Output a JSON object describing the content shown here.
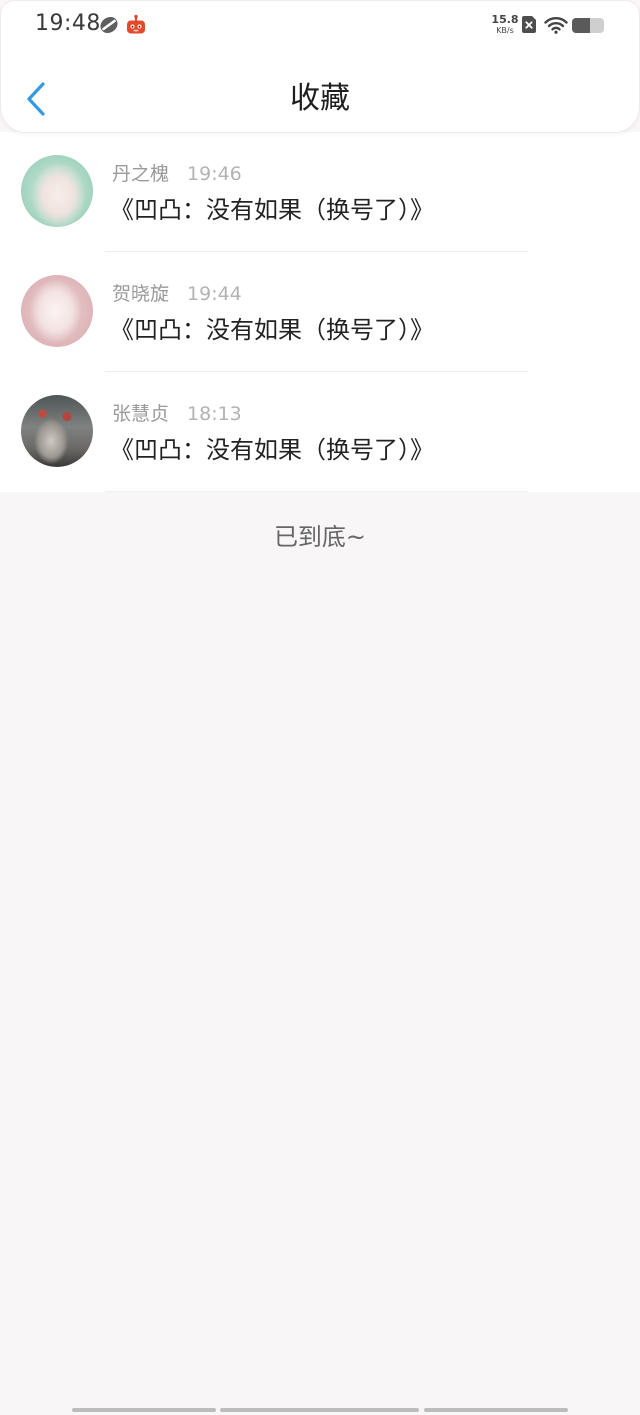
{
  "status_bar": {
    "time": "19:48",
    "notification_icons": [
      "swirl-app-icon",
      "robot-app-icon"
    ],
    "network_speed": "15.8",
    "network_speed_unit": "KB/s",
    "system_icons": [
      "no-sim-icon",
      "wifi-icon",
      "battery-icon"
    ],
    "battery_level": 0.55
  },
  "header": {
    "back_icon": "chevron-left-icon",
    "title": "收藏"
  },
  "favorites": [
    {
      "name": "丹之槐",
      "time": "19:46",
      "content": "《凹凸：没有如果（换号了）》"
    },
    {
      "name": "贺晓旋",
      "time": "19:44",
      "content": "《凹凸：没有如果（换号了）》"
    },
    {
      "name": "张慧贞",
      "time": "18:13",
      "content": "《凹凸：没有如果（换号了）》"
    }
  ],
  "footer": {
    "end_of_list": "已到底~"
  },
  "colors": {
    "accent": "#3399e6",
    "background": "#f8f6f7"
  }
}
